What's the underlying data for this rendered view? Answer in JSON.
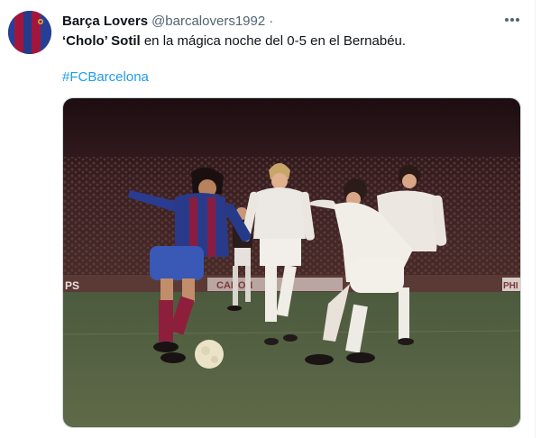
{
  "tweet": {
    "display_name": "Barça Lovers",
    "handle": "@barcalovers1992",
    "separator": "·",
    "text_part1": "‘Cholo’ Sotil",
    "text_part2": " en la mágica noche del 0-5 en el Bernabéu.",
    "hashtag": "#FCBarcelona",
    "more_icon": "more-horizontal-icon"
  },
  "media": {
    "description_icon": "photo",
    "ad_boards": [
      "PS",
      "CANON",
      "PHI"
    ]
  },
  "colors": {
    "text": "#0f1419",
    "secondary": "#536471",
    "link": "#1d9bf0",
    "barca_blue": "#1f3f8f",
    "barca_red": "#a3163b"
  }
}
